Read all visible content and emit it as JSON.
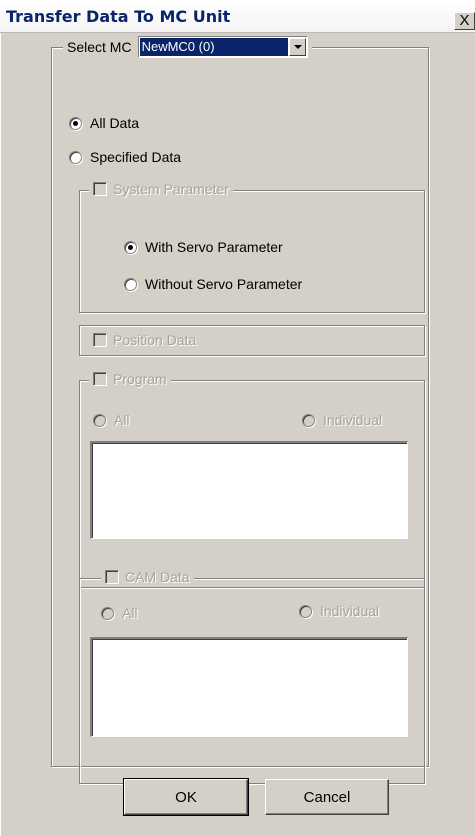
{
  "window": {
    "title": "Transfer Data To MC Unit",
    "close_glyph": "X"
  },
  "select_mc": {
    "label": "Select MC",
    "value": "NewMC0 (0)"
  },
  "transfer_mode": {
    "all_data": "All Data",
    "specified_data": "Specified Data",
    "selected": "all_data"
  },
  "system_parameter": {
    "label": "System Parameter",
    "with_servo": "With Servo Parameter",
    "without_servo": "Without Servo Parameter",
    "selected": "with_servo"
  },
  "position_data": {
    "label": "Position Data"
  },
  "program": {
    "label": "Program",
    "all": "All",
    "individual": "Individual"
  },
  "cam_data": {
    "label": "CAM Data",
    "all": "All",
    "individual": "Individual"
  },
  "buttons": {
    "ok": "OK",
    "cancel": "Cancel"
  }
}
